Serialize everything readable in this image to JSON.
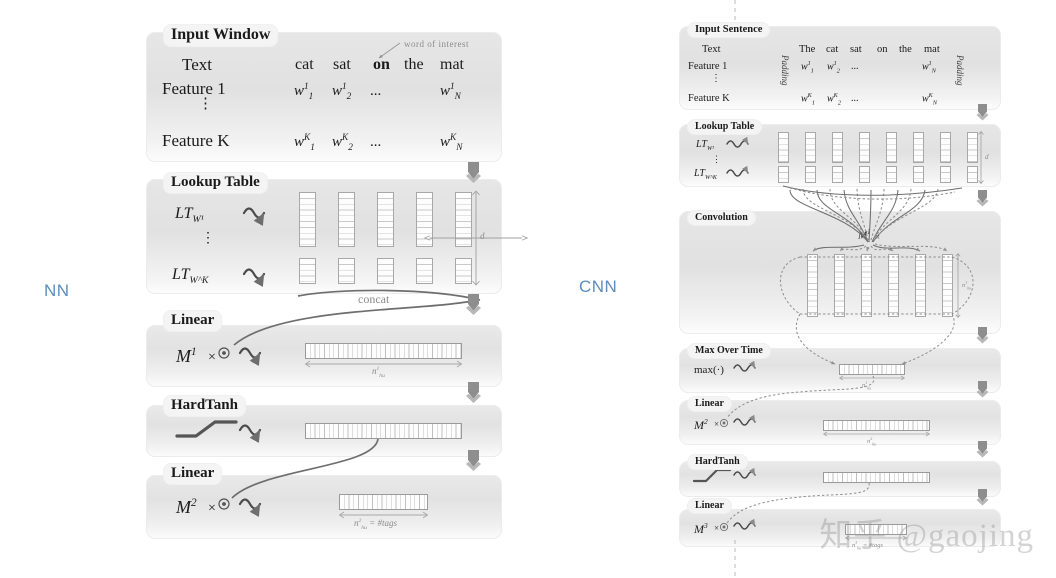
{
  "figure": {
    "background_color": "#ffffff",
    "panel_color": "#e6e6e6",
    "accent_color": "#5b8dbe",
    "ink_color": "#1b1b1b"
  },
  "watermark": {
    "text": "知乎 @gaojing"
  },
  "architectures": [
    {
      "key": "nn",
      "label": "NN"
    },
    {
      "key": "cnn",
      "label": "CNN"
    }
  ],
  "nn": {
    "panels": [
      {
        "title": "Input Window"
      },
      {
        "title": "Lookup Table"
      },
      {
        "title": "Linear"
      },
      {
        "title": "HardTanh"
      },
      {
        "title": "Linear"
      }
    ],
    "input_window": {
      "rows": [
        {
          "name": "Text",
          "cells": [
            "cat",
            "sat",
            "on",
            "the",
            "mat"
          ]
        },
        {
          "name": "Feature 1",
          "cells": [
            "w¹₁",
            "w¹₂",
            "…",
            "w¹_N"
          ]
        },
        {
          "name": "Feature K",
          "cells": [
            "w^K₁",
            "w^K₂",
            "…",
            "w^K_N"
          ]
        }
      ],
      "row_text_label": "Text",
      "row_f1_label": "Feature 1",
      "row_fk_label": "Feature K",
      "text_cells": [
        "cat",
        "sat",
        "on",
        "the",
        "mat"
      ],
      "highlighted_word": "on",
      "annotation": "word of interest",
      "vdots": "⋮",
      "f1": {
        "w1": "w",
        "w1_sub": "1",
        "w1_sup": "1",
        "w2_sub": "2",
        "w2_sup": "1",
        "dots": "...",
        "wN_sub": "N",
        "wN_sup": "1"
      },
      "fk": {
        "w1_sub": "1",
        "w1_sup": "K",
        "w2_sub": "2",
        "w2_sup": "K",
        "dots": "...",
        "wN_sub": "N",
        "wN_sup": "K"
      }
    },
    "lookup_table": {
      "row1_label": "LT",
      "row1_sub": "W¹",
      "rowk_label": "LT",
      "rowk_sub": "W^K",
      "vdots": "⋮",
      "dim_label": "d",
      "columns": 5,
      "concat_label": "concat"
    },
    "linear1": {
      "matrix": "M",
      "matrix_sup": "1",
      "op": "×",
      "size_label": "n",
      "size_sup": "1",
      "size_sub": "hu"
    },
    "hardtanh": {
      "glyph": "hardtanh-curve"
    },
    "linear2": {
      "matrix": "M",
      "matrix_sup": "2",
      "op": "×",
      "size_label": "n",
      "size_sup": "2",
      "size_sub": "hu",
      "size_eq": "= #tags"
    }
  },
  "cnn": {
    "panels": [
      {
        "title": "Input Sentence"
      },
      {
        "title": "Lookup Table"
      },
      {
        "title": "Convolution"
      },
      {
        "title": "Max Over Time"
      },
      {
        "title": "Linear"
      },
      {
        "title": "HardTanh"
      },
      {
        "title": "Linear"
      }
    ],
    "input_sentence": {
      "row_text_label": "Text",
      "row_f1_label": "Feature 1",
      "row_fk_label": "Feature K",
      "text_cells": [
        "The",
        "cat",
        "sat",
        "on",
        "the",
        "mat"
      ],
      "padding_label": "Padding",
      "vdots": "⋮",
      "f1": {
        "w1_sub": "1",
        "w1_sup": "1",
        "w2_sub": "2",
        "w2_sup": "1",
        "dots": "...",
        "wN_sub": "N",
        "wN_sup": "1"
      },
      "fk": {
        "w1_sub": "1",
        "w1_sup": "K",
        "w2_sub": "2",
        "w2_sup": "K",
        "dots": "...",
        "wN_sub": "N",
        "wN_sup": "K"
      }
    },
    "lookup_table": {
      "row1_label": "LT",
      "row1_sub": "W¹",
      "rowk_label": "LT",
      "rowk_sub": "W^K",
      "vdots": "⋮",
      "dim_label": "d",
      "columns": 8
    },
    "convolution": {
      "matrix": "M",
      "matrix_sup": "1",
      "op": "×",
      "size_label": "n",
      "size_sup": "1",
      "size_sub": "hu",
      "columns": 6
    },
    "max_over_time": {
      "op_label": "max(·)",
      "size_label": "n",
      "size_sup": "1",
      "size_sub": "hu"
    },
    "linear2": {
      "matrix": "M",
      "matrix_sup": "2",
      "op": "×",
      "size_label": "n",
      "size_sup": "2",
      "size_sub": "hu"
    },
    "hardtanh": {
      "glyph": "hardtanh-curve"
    },
    "linear3": {
      "matrix": "M",
      "matrix_sup": "3",
      "op": "×",
      "size_label": "n",
      "size_sup": "3",
      "size_sub": "hu",
      "size_eq": "= #tags"
    }
  }
}
